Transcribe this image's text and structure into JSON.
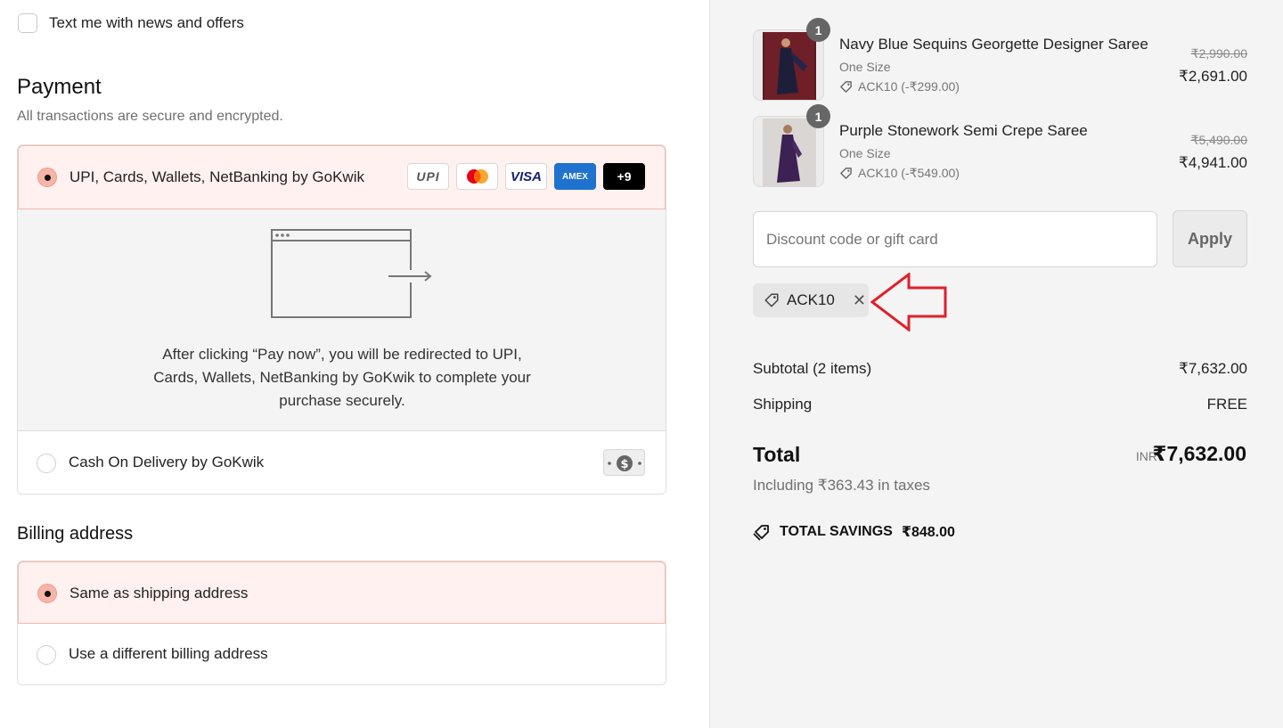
{
  "newsletter": {
    "label": "Text me with news and offers"
  },
  "payment": {
    "title": "Payment",
    "subtitle": "All transactions are secure and encrypted.",
    "option_gokwik": {
      "label": "UPI, Cards, Wallets, NetBanking by GoKwik",
      "logos": [
        "UPI",
        "Mastercard",
        "VISA",
        "AMEX",
        "+9"
      ],
      "redirect_text": "After clicking “Pay now”, you will be redirected to UPI, Cards, Wallets, NetBanking by GoKwik to complete your purchase securely."
    },
    "option_cod": {
      "label": "Cash On Delivery by GoKwik"
    }
  },
  "billing": {
    "title": "Billing address",
    "options": [
      "Same as shipping address",
      "Use a different billing address"
    ]
  },
  "cart": {
    "items": [
      {
        "qty": "1",
        "name": "Navy Blue Sequins Georgette Designer Saree",
        "size": "One Size",
        "discount": "ACK10 (-₹299.00)",
        "original_price": "₹2,990.00",
        "price": "₹2,691.00"
      },
      {
        "qty": "1",
        "name": "Purple Stonework Semi Crepe Saree",
        "size": "One Size",
        "discount": "ACK10 (-₹549.00)",
        "original_price": "₹5,490.00",
        "price": "₹4,941.00"
      }
    ],
    "discount_input": {
      "placeholder": "Discount code or gift card"
    },
    "apply_label": "Apply",
    "applied_code": "ACK10",
    "subtotal_label": "Subtotal (2 items)",
    "subtotal_value": "₹7,632.00",
    "shipping_label": "Shipping",
    "shipping_value": "FREE",
    "total_label": "Total",
    "currency": "INR",
    "total_value": "₹7,632.00",
    "tax_note": "Including ₹363.43 in taxes",
    "savings_label": "TOTAL SAVINGS",
    "savings_value": "₹848.00"
  },
  "colors": {
    "selected_bg": "#fff1ef",
    "selected_border": "#f2b8ad",
    "radio_selected": "#f6b5a8",
    "annotation_arrow": "#e0202a",
    "summary_bg": "#f4f4f4"
  }
}
